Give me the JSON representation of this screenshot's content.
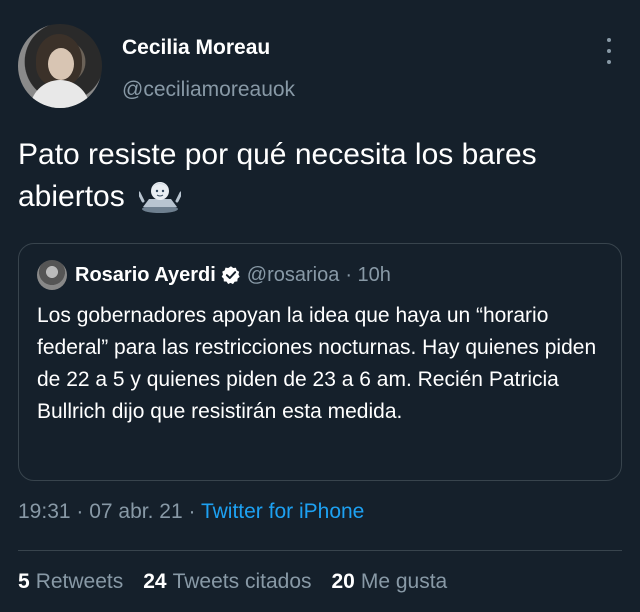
{
  "author": {
    "name": "Cecilia Moreau",
    "handle": "@ceciliamoreauok"
  },
  "tweet_text": "Pato resiste por qué necesita los bares abiertos",
  "emoji": "person-shrugging",
  "quoted": {
    "name": "Rosario Ayerdi",
    "handle": "@rosarioa",
    "time": "· 10h",
    "body": "Los gobernadores apoyan la idea que haya un “horario federal” para las restricciones nocturnas. Hay quienes piden de 22 a 5 y quienes piden de 23 a 6 am. Recién Patricia Bullrich dijo que resistirán esta medida."
  },
  "meta": {
    "time": "19:31",
    "sep1": " · ",
    "date": "07 abr. 21",
    "sep2": " · ",
    "source": "Twitter for iPhone"
  },
  "stats": {
    "retweets_count": "5",
    "retweets_label": "Retweets",
    "quotes_count": "24",
    "quotes_label": "Tweets citados",
    "likes_count": "20",
    "likes_label": "Me gusta"
  },
  "colors": {
    "background": "#15202b",
    "secondary_text": "#8899a6",
    "link": "#1da1f2",
    "border": "#38444d"
  }
}
